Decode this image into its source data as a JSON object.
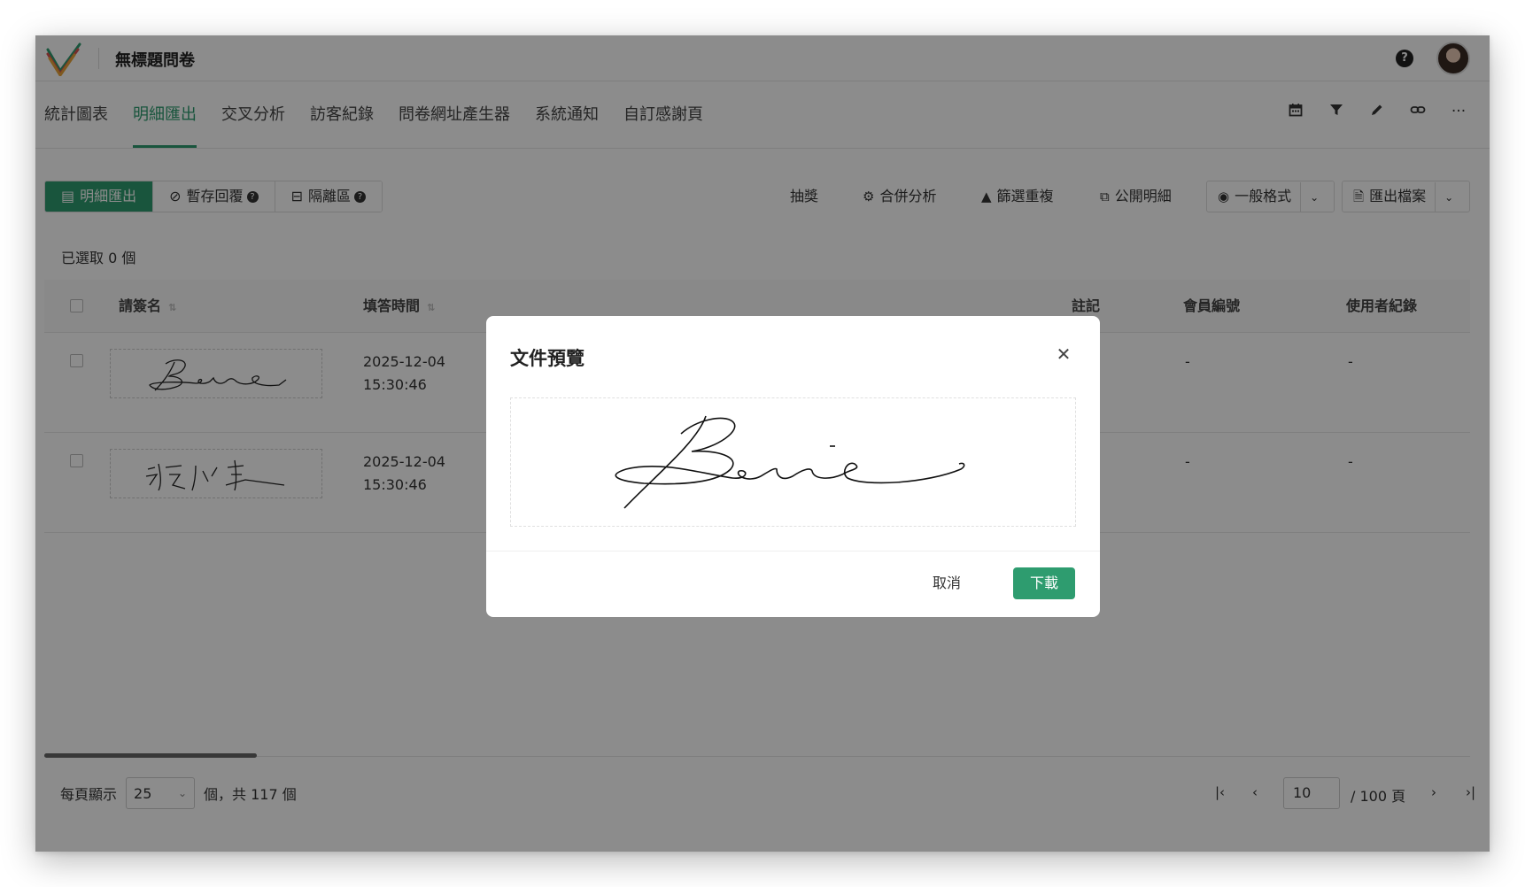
{
  "header": {
    "title": "無標題問卷",
    "help_icon": "help-circle-icon",
    "brand_colors": [
      "#2e9c6f",
      "#d9534f",
      "#e8a33a"
    ]
  },
  "tabs": [
    {
      "label": "統計圖表"
    },
    {
      "label": "明細匯出",
      "active": true
    },
    {
      "label": "交叉分析"
    },
    {
      "label": "訪客紀錄"
    },
    {
      "label": "問卷網址產生器"
    },
    {
      "label": "系統通知"
    },
    {
      "label": "自訂感謝頁"
    }
  ],
  "tab_tools": [
    "calendar-icon",
    "filter-icon",
    "pencil-icon",
    "link-icon",
    "more-icon"
  ],
  "toolbar": {
    "segments": [
      {
        "label": "明細匯出",
        "icon": "table-icon",
        "active": true
      },
      {
        "label": "暫存回覆",
        "icon": "ban-icon"
      },
      {
        "label": "隔離區",
        "icon": "minus-square-icon"
      }
    ],
    "lottery": "抽獎",
    "merge_analysis": "合併分析",
    "filter_duplicates": "篩選重複",
    "public_details": "公開明細",
    "view_format": "一般格式",
    "export_file": "匯出檔案"
  },
  "selection": {
    "text": "已選取 0 個"
  },
  "table": {
    "columns": [
      "請簽名",
      "填答時間",
      "註記",
      "會員編號",
      "使用者紀錄"
    ],
    "rows": [
      {
        "time": "2025-12-04\n15:30:46",
        "member_id": "-",
        "user_record": "-"
      },
      {
        "time": "2025-12-04\n15:30:46",
        "member_id": "-",
        "user_record": "-"
      }
    ]
  },
  "pagination": {
    "per_page_label": "每頁顯示",
    "per_page": "25",
    "total_text": "個，共 117 個",
    "current_page": "10",
    "total_pages_text": "/ 100 頁"
  },
  "modal": {
    "title": "文件預覽",
    "cancel": "取消",
    "download": "下載",
    "accent": "#2e9c6f"
  }
}
